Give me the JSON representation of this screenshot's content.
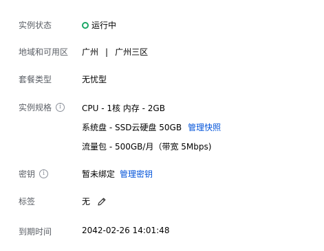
{
  "rows": {
    "status": {
      "label": "实例状态",
      "value": "运行中"
    },
    "region": {
      "label": "地域和可用区",
      "region": "广州",
      "separator": "|",
      "zone": "广州三区"
    },
    "plan": {
      "label": "套餐类型",
      "value": "无忧型"
    },
    "spec": {
      "label": "实例规格",
      "cpu": "CPU - 1核 内存 - 2GB",
      "disk": "系统盘 - SSD云硬盘 50GB",
      "disk_link": "管理快照",
      "traffic": "流量包 - 500GB/月（带宽 5Mbps)"
    },
    "key": {
      "label": "密钥",
      "value": "暂未绑定",
      "link": "管理密钥"
    },
    "tags": {
      "label": "标签",
      "value": "无"
    },
    "expiry": {
      "label": "到期时间",
      "value": "2042-02-26 14:01:48"
    }
  },
  "colors": {
    "status_green": "#1aa765",
    "link_blue": "#0052d9",
    "label_gray": "#5b5f66"
  },
  "icons": [
    "info-icon",
    "edit-icon",
    "status-dot-icon"
  ]
}
